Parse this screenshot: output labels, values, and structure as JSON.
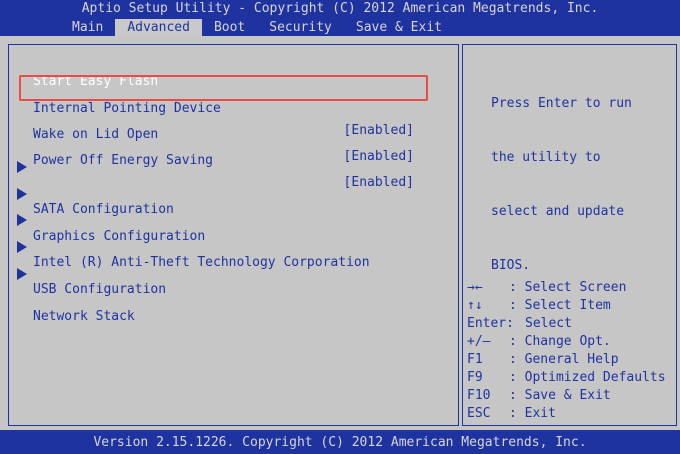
{
  "title": "Aptio Setup Utility - Copyright (C) 2012 American Megatrends, Inc.",
  "tabs": [
    {
      "label": "Main"
    },
    {
      "label": "Advanced"
    },
    {
      "label": "Boot"
    },
    {
      "label": "Security"
    },
    {
      "label": "Save & Exit"
    }
  ],
  "menu": {
    "start_easy_flash": "Start Easy Flash",
    "items": [
      {
        "label": "Internal Pointing Device",
        "value": "[Enabled]"
      },
      {
        "label": "Wake on Lid Open",
        "value": "[Enabled]"
      },
      {
        "label": "Power Off Energy Saving",
        "value": "[Enabled]"
      }
    ],
    "submenus": [
      {
        "label": "SATA Configuration"
      },
      {
        "label": "Graphics Configuration"
      },
      {
        "label": "Intel (R) Anti-Theft Technology Corporation"
      },
      {
        "label": "USB Configuration"
      },
      {
        "label": "Network Stack"
      }
    ]
  },
  "help": {
    "lines": [
      "Press Enter to run",
      "the utility to",
      "select and update",
      "BIOS."
    ]
  },
  "keys": [
    {
      "key": "→←",
      "desc": ": Select Screen"
    },
    {
      "key": "↑↓",
      "desc": ": Select Item"
    },
    {
      "key": "Enter:",
      "desc": "Select"
    },
    {
      "key": "+/—",
      "desc": ": Change Opt."
    },
    {
      "key": "F1",
      "desc": ": General Help"
    },
    {
      "key": "F9",
      "desc": ": Optimized Defaults"
    },
    {
      "key": "F10",
      "desc": ": Save & Exit"
    },
    {
      "key": "ESC",
      "desc": ": Exit"
    }
  ],
  "footer": "Version 2.15.1226. Copyright (C) 2012 American Megatrends, Inc.",
  "colors": {
    "accent": "#1f33a0",
    "panel": "#c6c6c6",
    "highlight": "#e84c45"
  }
}
